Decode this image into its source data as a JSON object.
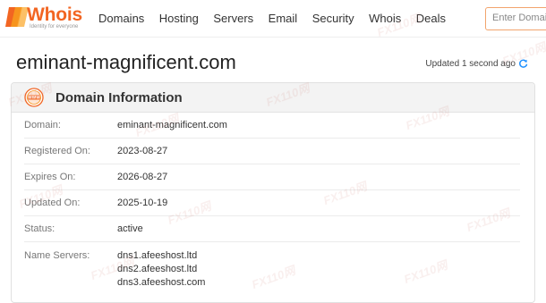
{
  "logo": {
    "word": "Whois",
    "tagline": "Identity for everyone",
    "brand_color": "#f26522"
  },
  "nav": {
    "items": [
      {
        "label": "Domains",
        "name": "nav-domains"
      },
      {
        "label": "Hosting",
        "name": "nav-hosting"
      },
      {
        "label": "Servers",
        "name": "nav-servers"
      },
      {
        "label": "Email",
        "name": "nav-email"
      },
      {
        "label": "Security",
        "name": "nav-security"
      },
      {
        "label": "Whois",
        "name": "nav-whois"
      },
      {
        "label": "Deals",
        "name": "nav-deals"
      }
    ]
  },
  "search": {
    "placeholder": "Enter Domai"
  },
  "page": {
    "title": "eminant-magnificent.com",
    "updated": "Updated 1 second ago"
  },
  "card": {
    "title": "Domain Information",
    "icon": "www-icon",
    "rows": [
      {
        "label": "Domain:",
        "value": "eminant-magnificent.com"
      },
      {
        "label": "Registered On:",
        "value": "2023-08-27"
      },
      {
        "label": "Expires On:",
        "value": "2026-08-27"
      },
      {
        "label": "Updated On:",
        "value": "2025-10-19"
      },
      {
        "label": "Status:",
        "value": "active"
      }
    ],
    "name_servers": {
      "label": "Name Servers:",
      "values": [
        "dns1.afeeshost.ltd",
        "dns2.afeeshost.ltd",
        "dns3.afeeshost.com"
      ]
    }
  },
  "watermark": "FX110网",
  "colors": {
    "accent": "#f26522",
    "refresh": "#1e90ff"
  }
}
